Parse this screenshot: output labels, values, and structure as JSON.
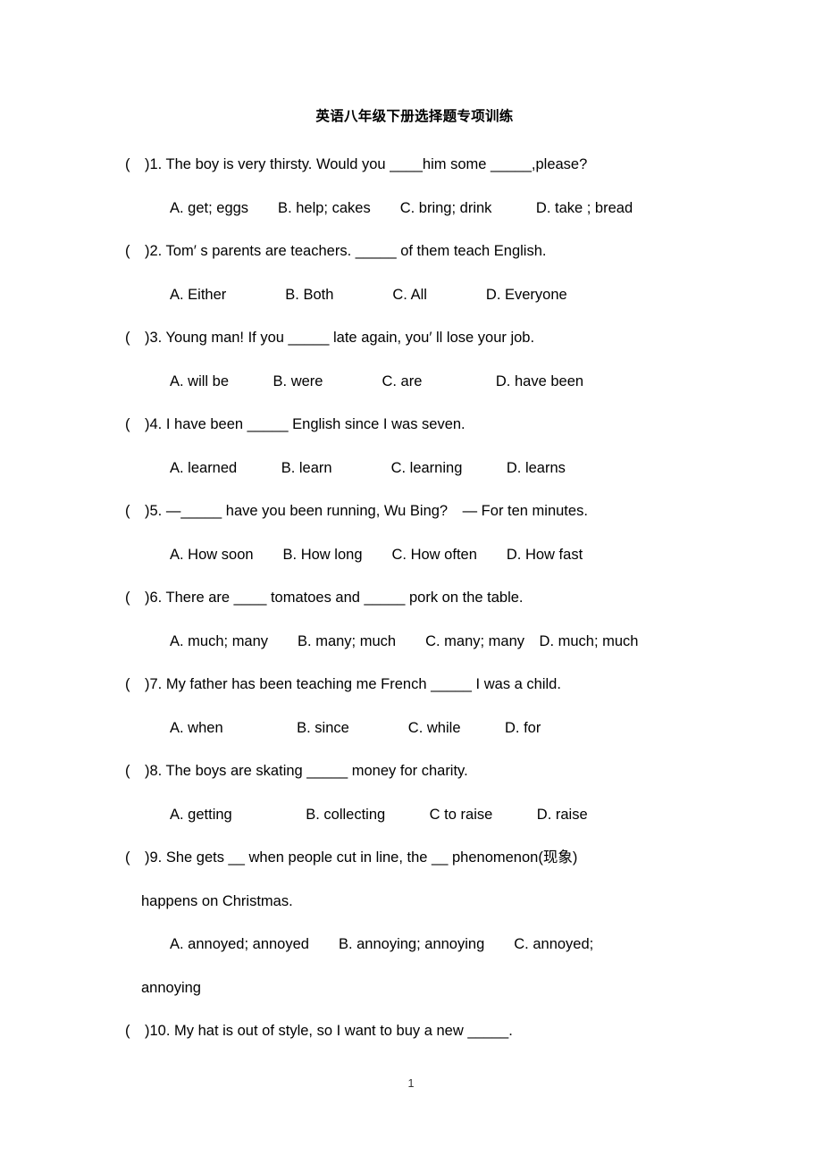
{
  "document": {
    "title": "英语八年级下册选择题专项训练",
    "page_number": "1"
  },
  "questions": [
    {
      "marker": "(　)1.",
      "stem": "The boy is very thirsty. Would you ____him some _____,please?",
      "options_line": "A. get; eggs　　B. help; cakes　　C. bring; drink　　　D. take ; bread",
      "options": [
        "A. get; eggs",
        "B. help; cakes",
        "C. bring; drink",
        "D. take ; bread"
      ]
    },
    {
      "marker": "(　)2.",
      "stem": "Tom′ s parents are teachers. _____ of them teach English.",
      "options_line": "A. Either　　　　B. Both　　　　C. All　　　　D. Everyone",
      "options": [
        "A. Either",
        "B. Both",
        "C. All",
        "D. Everyone"
      ]
    },
    {
      "marker": "(　)3.",
      "stem": "Young man! If you _____ late again, you′ ll lose your job.",
      "options_line": "A. will be　　　B. were　　　　C. are　　　　　D. have been",
      "options": [
        "A. will be",
        "B. were",
        "C. are",
        "D. have been"
      ]
    },
    {
      "marker": "(　)4.",
      "stem": "I have been _____ English since I was seven.",
      "options_line": "A. learned　　　B. learn　　　　C. learning　　　D. learns",
      "options": [
        "A. learned",
        "B. learn",
        "C. learning",
        "D. learns"
      ]
    },
    {
      "marker": "(　)5.",
      "stem": "—_____ have you been running, Wu Bing?　— For ten minutes.",
      "options_line": "A. How soon　　B. How long　　C. How often　　D. How fast",
      "options": [
        "A. How soon",
        "B. How long",
        "C. How often",
        "D. How fast"
      ]
    },
    {
      "marker": "(　)6.",
      "stem": "There are ____ tomatoes and _____ pork on the table.",
      "options_line": "A. much; many　　B. many; much　　C. many; many　D. much; much",
      "options": [
        "A. much; many",
        "B. many; much",
        "C. many; many",
        "D. much; much"
      ]
    },
    {
      "marker": "(　)7.",
      "stem": "My father has been teaching me French _____ I was a child.",
      "options_line": "A. when　　　　　B. since　　　　C. while　　　D. for",
      "options": [
        "A. when",
        "B. since",
        "C. while",
        "D. for"
      ]
    },
    {
      "marker": "(　)8.",
      "stem": "The boys are skating _____ money for charity.",
      "options_line": "A. getting　　　　　B. collecting　　　C to raise　　　D. raise",
      "options": [
        "A. getting",
        "B. collecting",
        "C to raise",
        "D. raise"
      ]
    },
    {
      "marker": "(　)9.",
      "stem": "She gets __ when people cut in line, the __ phenomenon(现象)",
      "stem_cont": "happens on Christmas.",
      "options_line": "A. annoyed; annoyed　　B. annoying; annoying　　C. annoyed;",
      "options_cont": "annoying",
      "options": [
        "A. annoyed; annoyed",
        "B. annoying; annoying",
        "C. annoyed; annoying"
      ]
    },
    {
      "marker": "(　)10.",
      "stem": "My hat is out of style, so I want to buy a new _____.",
      "options_line": "",
      "options": []
    }
  ]
}
